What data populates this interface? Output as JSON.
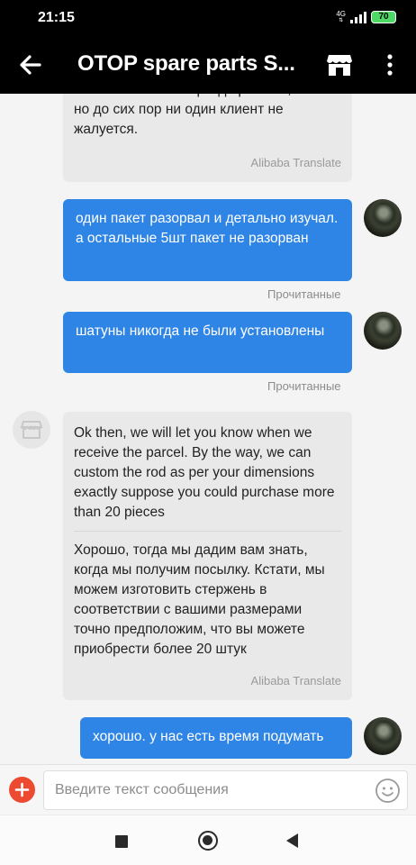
{
  "status_bar": {
    "time": "21:15",
    "network": "4G",
    "battery": "70"
  },
  "header": {
    "title": "OTOP spare parts S..."
  },
  "messages": [
    {
      "direction": "in",
      "partial_text": "мы можем знать гораздо раньше,\nно до сих пор ни один клиент не\nжалуется.",
      "translation_label": "Alibaba Translate"
    },
    {
      "direction": "out",
      "text": "один пакет разорвал и детально изучал. а остальные 5шт пакет не разорван",
      "status": "Прочитанные"
    },
    {
      "direction": "out",
      "text": "шатуны никогда не были установлены",
      "status": "Прочитанные"
    },
    {
      "direction": "in",
      "text": "Ok then, we will let you know when we receive the parcel. By the way, we can custom the rod as per your dimensions exactly suppose you could purchase more than 20 pieces",
      "translated": "Хорошо, тогда мы дадим вам знать, когда мы получим посылку. Кстати, мы можем изготовить стержень в соответствии с вашими размерами точно предположим, что вы можете приобрести более 20 штук",
      "translation_label": "Alibaba Translate"
    },
    {
      "direction": "out",
      "text": "хорошо. у нас есть время подумать"
    }
  ],
  "composer": {
    "placeholder": "Введите текст сообщения",
    "value": ""
  },
  "colors": {
    "outgoing_bubble": "#2f85e6",
    "incoming_bubble": "#e9e9e9",
    "add_button": "#ec4b32",
    "header_bg": "#000000"
  },
  "icons": {
    "back": "arrow-left-icon",
    "store": "store-icon",
    "menu": "more-vertical-icon",
    "add": "plus-icon",
    "emoji": "smiley-icon"
  }
}
